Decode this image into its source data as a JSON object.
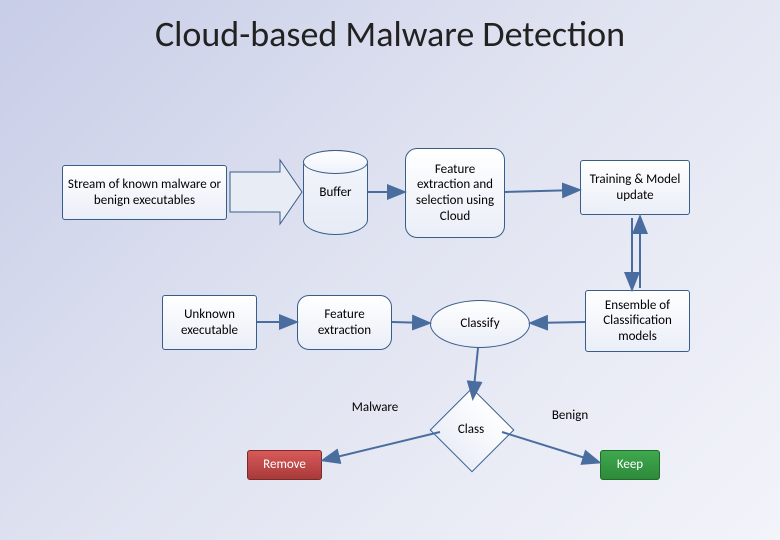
{
  "title": "Cloud-based Malware Detection",
  "nodes": {
    "stream": "Stream of known malware or benign executables",
    "buffer": "Buffer",
    "feature_cloud": "Feature extraction and selection using Cloud",
    "training": "Training & Model update",
    "unknown": "Unknown executable",
    "feature_extract": "Feature extraction",
    "classify": "Classify",
    "ensemble": "Ensemble of Classification models",
    "class": "Class"
  },
  "edges": {
    "malware": "Malware",
    "benign": "Benign"
  },
  "actions": {
    "remove": "Remove",
    "keep": "Keep"
  },
  "colors": {
    "remove": "#c0504d",
    "keep": "#359446"
  }
}
